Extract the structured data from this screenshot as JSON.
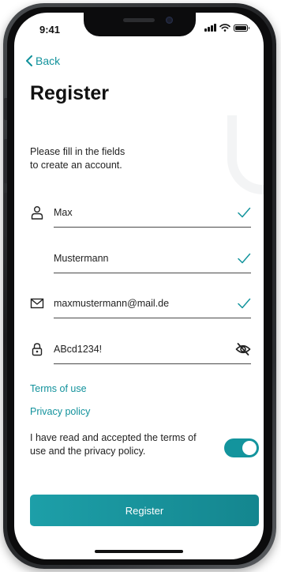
{
  "status": {
    "time": "9:41"
  },
  "nav": {
    "back_label": "Back"
  },
  "page": {
    "title": "Register",
    "intro_line1": "Please fill in the fields",
    "intro_line2": "to create an account."
  },
  "form": {
    "first_name": "Max",
    "last_name": "Mustermann",
    "email": "maxmustermann@mail.de",
    "password": "ABcd1234!"
  },
  "links": {
    "terms": "Terms of use",
    "privacy": "Privacy policy"
  },
  "consent": {
    "text_line1": "I have read and accepted the terms of",
    "text_line2": "use and the privacy policy.",
    "accepted": true
  },
  "actions": {
    "register_label": "Register"
  },
  "icons": {
    "back": "chevron-left-icon",
    "person": "person-icon",
    "mail": "mail-icon",
    "lock": "lock-icon",
    "check": "check-icon",
    "visibility": "eye-off-icon"
  },
  "colors": {
    "accent": "#13949d",
    "text": "#222222"
  }
}
